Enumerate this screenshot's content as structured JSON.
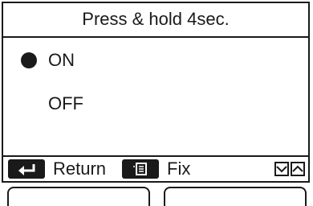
{
  "screen": {
    "title": "Press & hold 4sec.",
    "options": [
      {
        "label": "ON",
        "selected": true
      },
      {
        "label": "OFF",
        "selected": false
      }
    ]
  },
  "footer": {
    "return_label": "Return",
    "fix_label": "Fix",
    "icons": [
      "return-icon",
      "menu-icon",
      "down-arrow-icon",
      "up-arrow-icon"
    ]
  },
  "colors": {
    "foreground": "#1a1a1a",
    "background": "#ffffff"
  }
}
